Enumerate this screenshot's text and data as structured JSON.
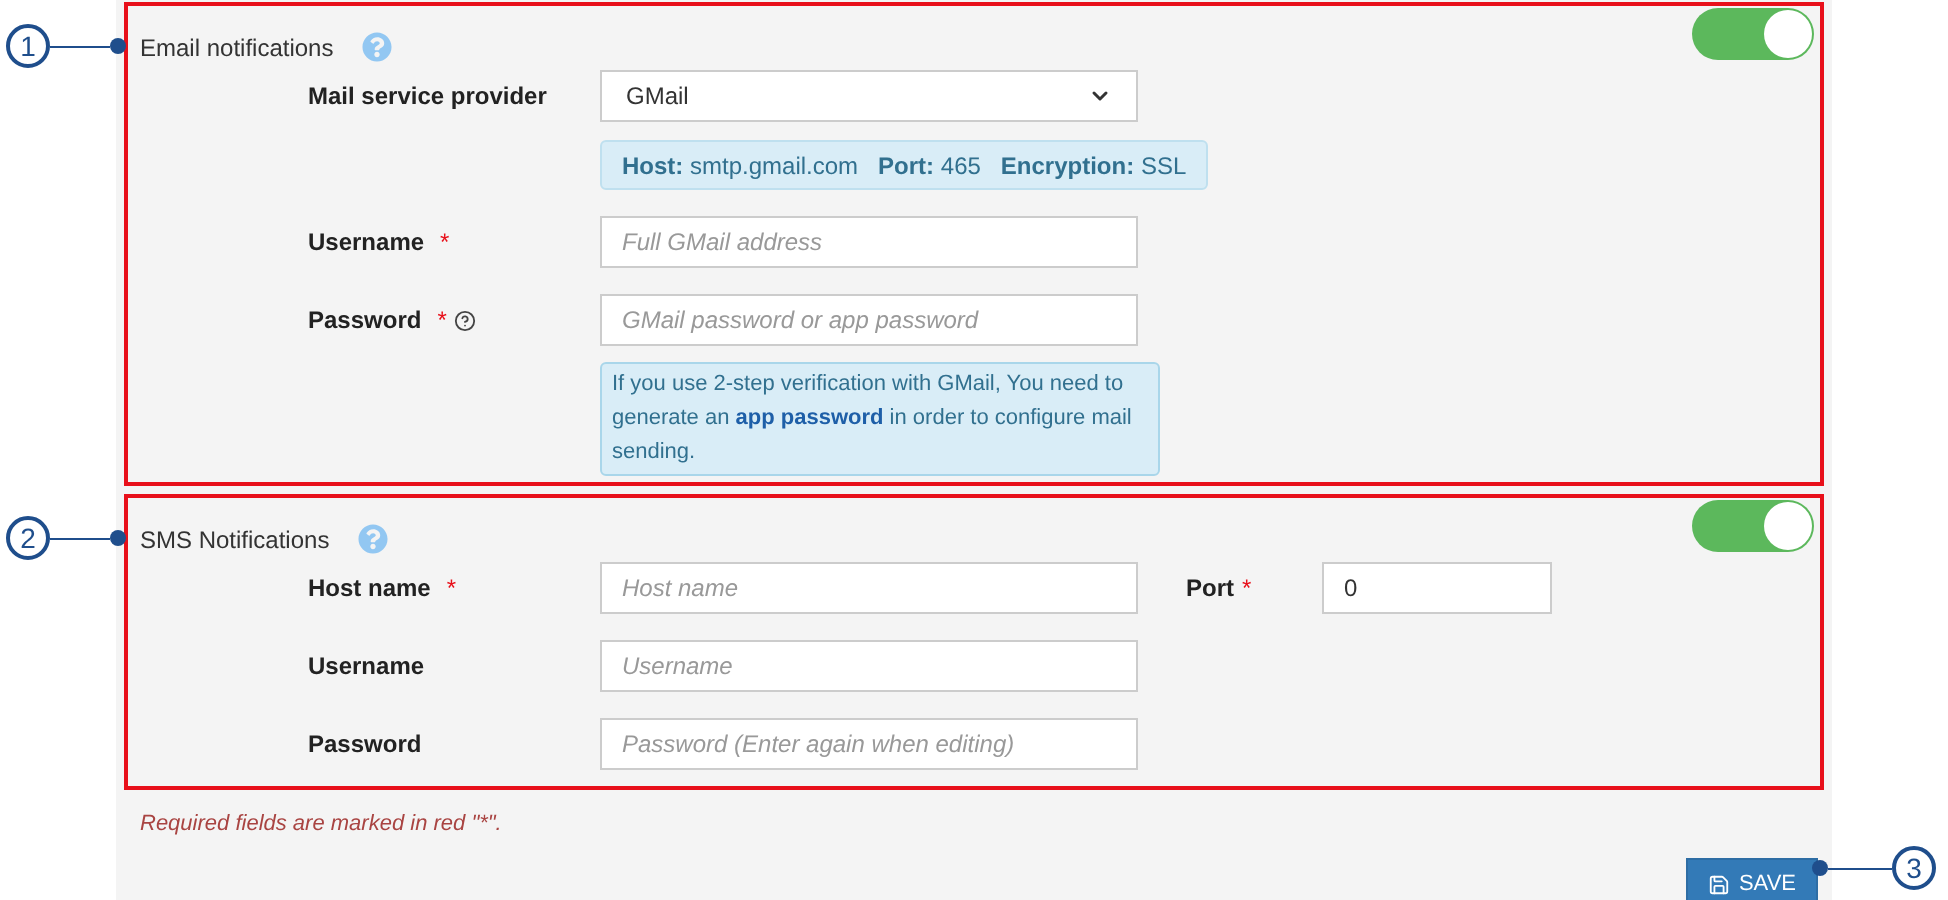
{
  "callouts": [
    {
      "label": "1"
    },
    {
      "label": "2"
    },
    {
      "label": "3"
    }
  ],
  "sections": [
    {
      "title": "Email notifications",
      "help": true,
      "on": true,
      "rows": [
        {
          "kind": "select",
          "label": "Mail service provider",
          "value": "GMail"
        },
        {
          "kind": "info",
          "parts": [
            {
              "key": "Host:",
              "value": "smtp.gmail.com"
            },
            {
              "key": "Port:",
              "value": "465"
            },
            {
              "key": "Encryption:",
              "value": "SSL"
            }
          ]
        },
        {
          "kind": "input",
          "label": "Username",
          "marker": "*",
          "placeholder": "Full GMail address"
        },
        {
          "kind": "input",
          "label": "Password",
          "marker": "*",
          "help": true,
          "placeholder": "GMail password or app password"
        },
        {
          "kind": "note",
          "text": "If you use 2-step verification with GMail, You need to generate an **app password** in order to configure mail sending."
        }
      ]
    },
    {
      "title": "SMS Notifications",
      "help": true,
      "on": true,
      "rows": [
        {
          "kind": "input",
          "label": "Host name",
          "marker": "*",
          "placeholder": "Host name",
          "extra": {
            "label": "Port",
            "marker": "*",
            "value": "0"
          }
        },
        {
          "kind": "input",
          "label": "Username",
          "placeholder": "Username"
        },
        {
          "kind": "input",
          "label": "Password",
          "placeholder": "Password (Enter again when editing)"
        }
      ]
    }
  ],
  "footnote": "Required fields are marked in red \"*\".",
  "save_button": {
    "label": "SAVE"
  }
}
